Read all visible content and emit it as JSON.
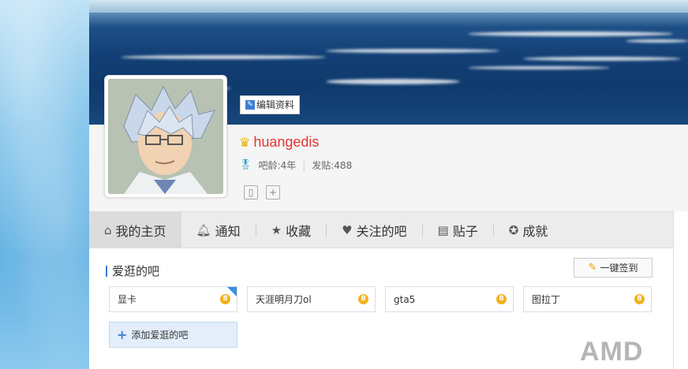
{
  "profile": {
    "edit_label": "编辑资料",
    "username": "huangedis",
    "age_label": "吧龄:4年",
    "posts_label": "发贴:488"
  },
  "nav": {
    "items": [
      {
        "label": "我的主页",
        "icon": "home-icon"
      },
      {
        "label": "通知",
        "icon": "bell-icon"
      },
      {
        "label": "收藏",
        "icon": "star-icon"
      },
      {
        "label": "关注的吧",
        "icon": "heart-icon"
      },
      {
        "label": "贴子",
        "icon": "document-icon"
      },
      {
        "label": "成就",
        "icon": "award-icon"
      }
    ]
  },
  "section": {
    "title": "爱逛的吧",
    "sign_label": "一键签到",
    "add_label": "添加爱逛的吧"
  },
  "forums": [
    {
      "name": "显卡",
      "level": "8"
    },
    {
      "name": "天涯明月刀ol",
      "level": "8"
    },
    {
      "name": "gta5",
      "level": "8"
    },
    {
      "name": "图拉丁",
      "level": "8"
    }
  ],
  "watermark": "AMD",
  "colors": {
    "accent": "#3b7fd1",
    "username": "#e53333",
    "badge": "#f2b21b"
  }
}
